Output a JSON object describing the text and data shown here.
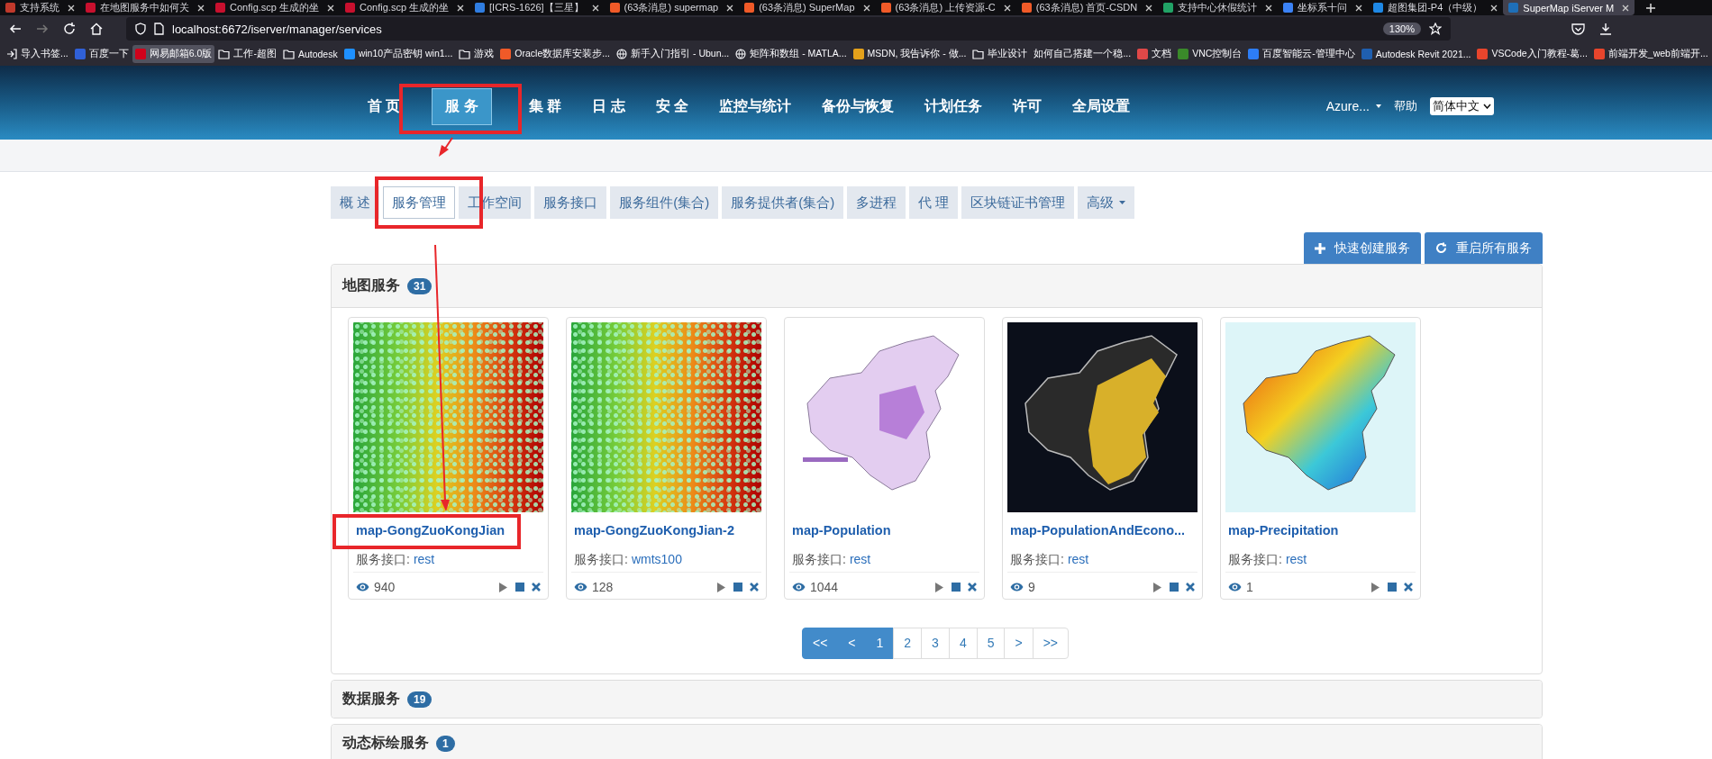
{
  "browser": {
    "tabs": [
      {
        "title": "支持系统",
        "color": "#c0392b",
        "selected": false
      },
      {
        "title": "在地图服务中如何关",
        "color": "#c8102e",
        "selected": false
      },
      {
        "title": "Config.scp 生成的坐",
        "color": "#c8102e",
        "selected": false
      },
      {
        "title": "Config.scp 生成的坐",
        "color": "#c8102e",
        "selected": false
      },
      {
        "title": "[ICRS-1626]【三星】",
        "color": "#2f7de1",
        "selected": false
      },
      {
        "title": "(63条消息) supermap",
        "color": "#f05a28",
        "selected": false
      },
      {
        "title": "(63条消息) SuperMap",
        "color": "#f05a28",
        "selected": false
      },
      {
        "title": "(63条消息) 上传资源-C",
        "color": "#f05a28",
        "selected": false
      },
      {
        "title": "(63条消息) 首页-CSDN",
        "color": "#f05a28",
        "selected": false
      },
      {
        "title": "支持中心休假统计",
        "color": "#21a366",
        "selected": false
      },
      {
        "title": "坐标系十问",
        "color": "#3b82f6",
        "selected": false
      },
      {
        "title": "超图集团-P4（中级）",
        "color": "#1e88e5",
        "selected": false
      },
      {
        "title": "SuperMap iServer M",
        "color": "#1e6fb8",
        "selected": true
      }
    ],
    "address": {
      "url": "localhost:6672/iserver/manager/services",
      "zoom": "130%"
    },
    "bookmarks": [
      {
        "label": "导入书签...",
        "kind": "import",
        "hovered": false
      },
      {
        "label": "百度一下",
        "kind": "site",
        "color": "#3060d8",
        "hovered": false
      },
      {
        "label": "网易邮箱6.0版",
        "kind": "site",
        "color": "#d0021b",
        "hovered": true
      },
      {
        "label": "工作-超图",
        "kind": "folder",
        "hovered": false
      },
      {
        "label": "Autodesk",
        "kind": "folder",
        "hovered": false
      },
      {
        "label": "win10产品密钥 win1...",
        "kind": "site",
        "color": "#1e90ff",
        "hovered": false
      },
      {
        "label": "游戏",
        "kind": "folder",
        "hovered": false
      },
      {
        "label": "Oracle数据库安装步...",
        "kind": "site",
        "color": "#f05a28",
        "hovered": false
      },
      {
        "label": "新手入门指引 - Ubun...",
        "kind": "globe",
        "hovered": false
      },
      {
        "label": "矩阵和数组 - MATLA...",
        "kind": "globe",
        "hovered": false
      },
      {
        "label": "MSDN, 我告诉你 - 做...",
        "kind": "site",
        "color": "#e4a11b",
        "hovered": false
      },
      {
        "label": "毕业设计",
        "kind": "folder",
        "hovered": false
      },
      {
        "label": "如何自己搭建一个稳...",
        "kind": "none",
        "hovered": false
      },
      {
        "label": "文档",
        "kind": "site",
        "color": "#e04848",
        "hovered": false
      },
      {
        "label": "VNC控制台",
        "kind": "site",
        "color": "#3a8a2a",
        "hovered": false
      },
      {
        "label": "百度智能云-管理中心",
        "kind": "site",
        "color": "#2d7df6",
        "hovered": false
      },
      {
        "label": "Autodesk Revit 2021...",
        "kind": "site",
        "color": "#1f5fb0",
        "hovered": false
      },
      {
        "label": "VSCode入门教程-葛...",
        "kind": "site",
        "color": "#e8452c",
        "hovered": false
      },
      {
        "label": "前端开发_web前端开...",
        "kind": "site",
        "color": "#e8452c",
        "hovered": false
      }
    ]
  },
  "header": {
    "nav": [
      {
        "label": "首 页",
        "selected": false
      },
      {
        "label": "服 务",
        "selected": true
      },
      {
        "label": "集 群",
        "selected": false
      },
      {
        "label": "日 志",
        "selected": false
      },
      {
        "label": "安 全",
        "selected": false
      },
      {
        "label": "监控与统计",
        "selected": false
      },
      {
        "label": "备份与恢复",
        "selected": false
      },
      {
        "label": "计划任务",
        "selected": false
      },
      {
        "label": "许可",
        "selected": false
      },
      {
        "label": "全局设置",
        "selected": false
      }
    ],
    "user": "Azure...",
    "help": "帮助",
    "language": "简体中文"
  },
  "sub_tabs": [
    {
      "label": "概 述",
      "selected": false,
      "kind": "plain"
    },
    {
      "label": "服务管理",
      "selected": true,
      "kind": "plain"
    },
    {
      "label": "工作空间",
      "selected": false,
      "kind": "plain"
    },
    {
      "label": "服务接口",
      "selected": false,
      "kind": "plain"
    },
    {
      "label": "服务组件(集合)",
      "selected": false,
      "kind": "plain"
    },
    {
      "label": "服务提供者(集合)",
      "selected": false,
      "kind": "plain"
    },
    {
      "label": "多进程",
      "selected": false,
      "kind": "plain"
    },
    {
      "label": "代 理",
      "selected": false,
      "kind": "plain"
    },
    {
      "label": "区块链证书管理",
      "selected": false,
      "kind": "plain"
    },
    {
      "label": "高级",
      "selected": false,
      "kind": "dropdown"
    }
  ],
  "actions": [
    {
      "label": "快速创建服务",
      "kind": "add"
    },
    {
      "label": "重启所有服务",
      "kind": "restart"
    }
  ],
  "panels": [
    {
      "title": "地图服务",
      "count": "31",
      "expanded": true,
      "cards": [
        {
          "title": "map-GongZuoKongJian",
          "interface_label": "服务接口:",
          "interface": "rest",
          "views": "940",
          "kind": "heatmap"
        },
        {
          "title": "map-GongZuoKongJian-2",
          "interface_label": "服务接口:",
          "interface": "wmts100",
          "views": "128",
          "kind": "heatmap"
        },
        {
          "title": "map-Population",
          "interface_label": "服务接口:",
          "interface": "rest",
          "views": "1044",
          "kind": "region-map"
        },
        {
          "title": "map-PopulationAndEcono...",
          "interface_label": "服务接口:",
          "interface": "rest",
          "views": "9",
          "kind": "dark-map"
        },
        {
          "title": "map-Precipitation",
          "interface_label": "服务接口:",
          "interface": "rest",
          "views": "1",
          "kind": "contour-map"
        }
      ],
      "pagination": [
        {
          "label": "<<",
          "active": true
        },
        {
          "label": "<",
          "active": true
        },
        {
          "label": "1",
          "active": true
        },
        {
          "label": "2",
          "active": false
        },
        {
          "label": "3",
          "active": false
        },
        {
          "label": "4",
          "active": false
        },
        {
          "label": "5",
          "active": false
        },
        {
          "label": ">",
          "active": false
        },
        {
          "label": ">>",
          "active": false
        }
      ]
    },
    {
      "title": "数据服务",
      "count": "19",
      "expanded": false
    },
    {
      "title": "动态标绘服务",
      "count": "1",
      "expanded": false
    }
  ]
}
